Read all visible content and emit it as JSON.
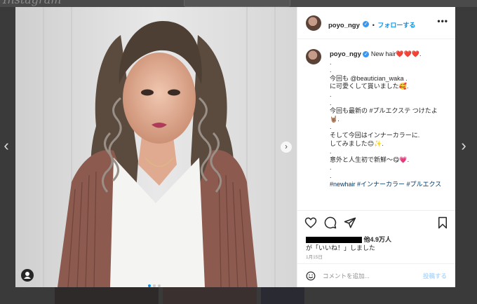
{
  "background": {
    "logo_text": "Instagram"
  },
  "post": {
    "username": "poyo_ngy",
    "follow_label": "フォローする",
    "dot": "•",
    "more_label": "•••",
    "caption_lines": [
      "New hair❤️❤️❤️.",
      ".",
      ".",
      "今回も @beautician_waka .",
      "に可愛くして貰いました🥰.",
      ".",
      ".",
      "今回も最新の #プルエクステ つけたよ",
      "🤘🏽.",
      ".",
      "そして今回はインナーカラーに.",
      "してみました😊✨.",
      ".",
      "意外と人生初で新鮮〜😋💗.",
      ".",
      ".",
      "#newhair #インナーカラー #プルエクス"
    ],
    "likes_count": "他4.9万人",
    "likes_suffix": "が「いいね！」しました",
    "date": "1月15日",
    "comment_placeholder": "コメントを追加...",
    "post_button": "投稿する"
  },
  "icons": {
    "heart": "heart-icon",
    "comment": "comment-icon",
    "share": "share-icon",
    "bookmark": "bookmark-icon",
    "emoji": "emoji-icon",
    "user_tag": "user-tag-icon"
  },
  "colors": {
    "accent": "#0095f6",
    "verified": "#3897f0",
    "hashtag": "#00376b"
  }
}
